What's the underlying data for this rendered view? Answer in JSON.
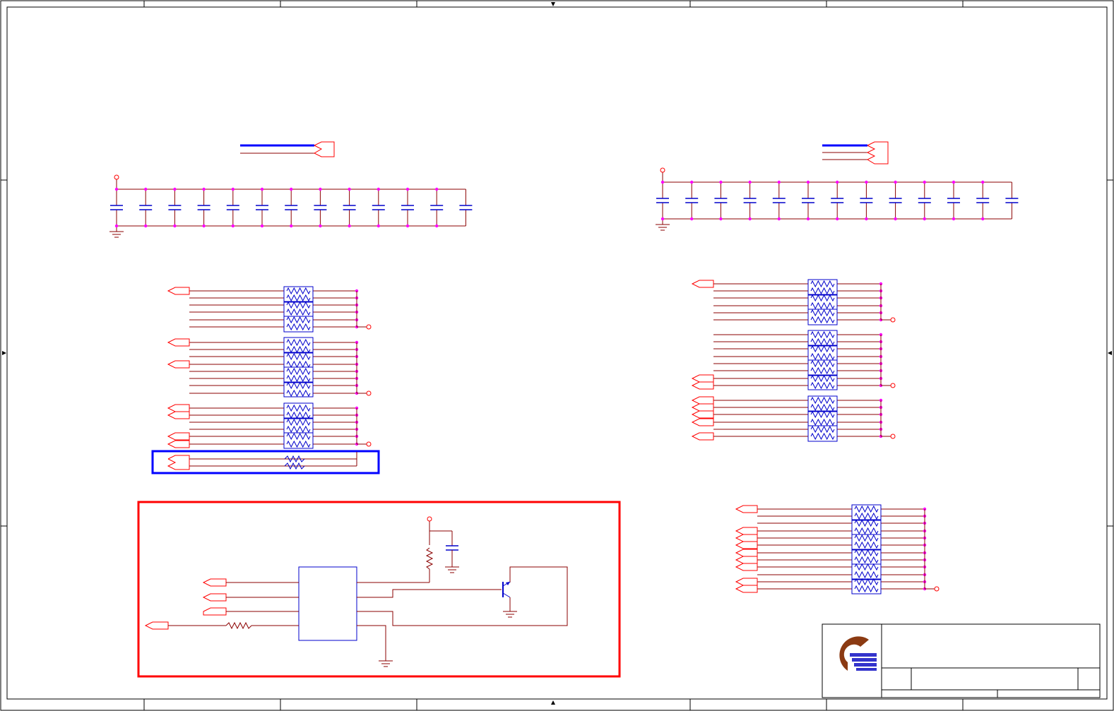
{
  "sheet": {
    "title_block": {
      "logo_name": "company-logo",
      "title": "",
      "document_number": "",
      "revision": "",
      "sheet_info": ""
    }
  },
  "colors": {
    "wire": "#8b0000",
    "port": "#ff0000",
    "component": "#0000cc",
    "junction": "#ff00ff",
    "highlight_red": "#ff0000",
    "highlight_blue": "#0000ff",
    "logo_brown": "#8b3a12",
    "logo_blue": "#3333cc"
  },
  "cap_banks": [
    {
      "name": "decoupling-bank-left",
      "count": 13
    },
    {
      "name": "decoupling-bank-right",
      "count": 13
    }
  ],
  "resistor_networks": [
    {
      "name": "rnet-left",
      "packs": 12
    },
    {
      "name": "rnet-right",
      "packs": 12
    },
    {
      "name": "rnet-bottom-right",
      "packs": 6
    }
  ],
  "highlight_boxes": [
    {
      "name": "blue-highlight-box",
      "color": "blue"
    },
    {
      "name": "red-highlight-box",
      "color": "red"
    }
  ]
}
